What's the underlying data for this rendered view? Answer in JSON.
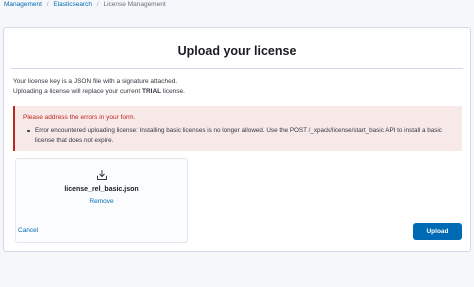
{
  "breadcrumbs": [
    {
      "label": "Management"
    },
    {
      "label": "Elasticsearch"
    },
    {
      "label": "License Management"
    }
  ],
  "breadcrumb_separator": "/",
  "page": {
    "title": "Upload your license",
    "description_line1": "Your license key is a JSON file with a signature attached.",
    "description_line2_pre": "Uploading a license will replace your current ",
    "description_line2_strong": "TRIAL",
    "description_line2_post": " license."
  },
  "error_callout": {
    "title": "Please address the errors in your form.",
    "errors": [
      "Error encountered uploading license: Installing basic licenses is no longer allowed. Use the POST /_xpack/license/start_basic API to install a basic license that does not expire."
    ]
  },
  "file_picker": {
    "icon": "file-import-icon",
    "file_name": "license_rel_basic.json",
    "remove_label": "Remove"
  },
  "actions": {
    "cancel_label": "Cancel",
    "upload_label": "Upload"
  },
  "colors": {
    "accent": "#006bb4",
    "danger": "#bd271e",
    "danger_background": "#f8e9e9"
  }
}
